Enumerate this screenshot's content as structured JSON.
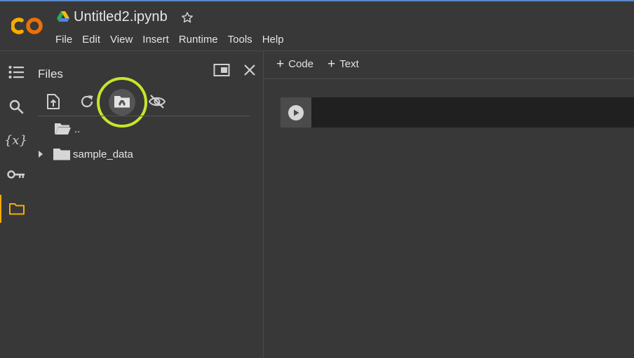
{
  "app": {
    "logo_text": "CO",
    "notebook_title": "Untitled2.ipynb"
  },
  "menu": [
    "File",
    "Edit",
    "View",
    "Insert",
    "Runtime",
    "Tools",
    "Help"
  ],
  "rail": {
    "items": [
      "table-of-contents",
      "search",
      "variables",
      "secrets",
      "files"
    ],
    "active": "files",
    "variables_glyph": "{x}"
  },
  "files_panel": {
    "title": "Files",
    "toolbar": [
      "upload-icon",
      "refresh-icon",
      "mount-drive-icon",
      "hide-icon"
    ],
    "highlighted_tool": "mount-drive-icon",
    "tree": [
      {
        "label": "..",
        "type": "parent-folder"
      },
      {
        "label": "sample_data",
        "type": "folder",
        "expandable": true
      }
    ]
  },
  "main": {
    "add_code_label": "Code",
    "add_text_label": "Text"
  },
  "colors": {
    "background": "#383838",
    "cell_bg": "#202020",
    "highlight_ring": "#c6e52c",
    "active_accent": "#f9ab00",
    "logo_orange": "#f9ab00"
  }
}
